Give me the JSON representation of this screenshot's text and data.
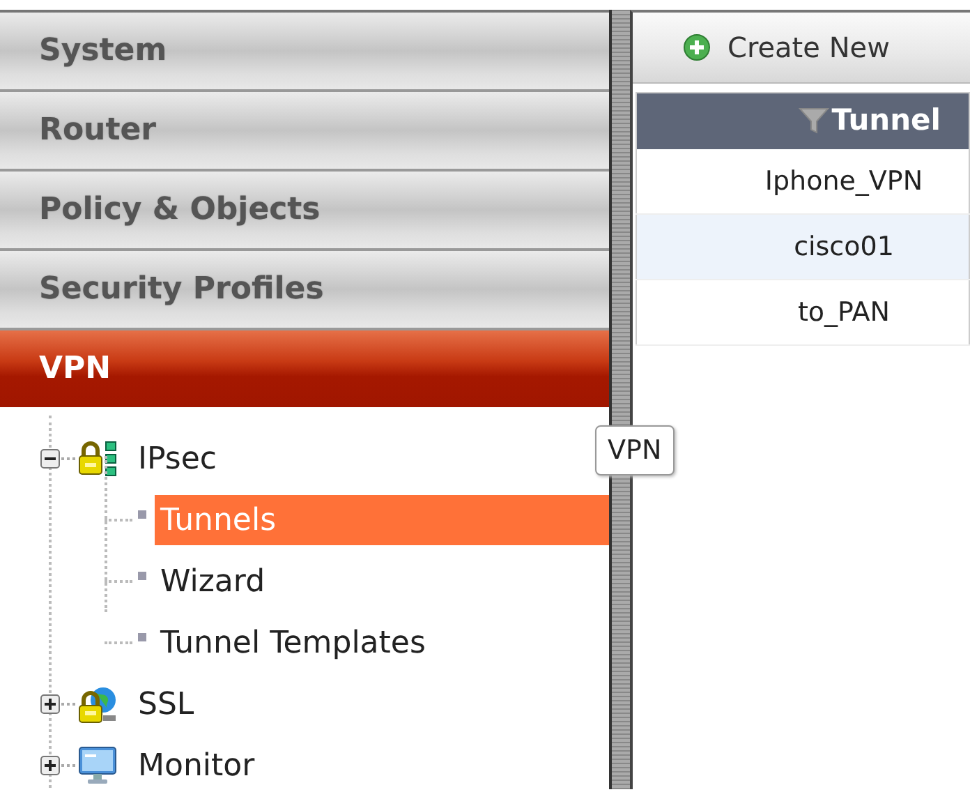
{
  "nav_sections": [
    {
      "label": "System",
      "selected": false
    },
    {
      "label": "Router",
      "selected": false
    },
    {
      "label": "Policy & Objects",
      "selected": false
    },
    {
      "label": "Security Profiles",
      "selected": false
    },
    {
      "label": "VPN",
      "selected": true
    }
  ],
  "tree": [
    {
      "label": "IPsec",
      "kind": "lock-network",
      "expanded": true,
      "selected": false,
      "children": [
        {
          "label": "Tunnels",
          "selected": true
        },
        {
          "label": "Wizard",
          "selected": false
        },
        {
          "label": "Tunnel Templates",
          "selected": false
        }
      ]
    },
    {
      "label": "SSL",
      "kind": "lock-globe",
      "expanded": false,
      "selected": false
    },
    {
      "label": "Monitor",
      "kind": "monitor",
      "expanded": false,
      "selected": false
    }
  ],
  "tooltip": {
    "text": "VPN"
  },
  "toolbar": {
    "create_button": "Create New"
  },
  "table": {
    "columns": [
      {
        "label": "Tunnel",
        "filter": true
      }
    ],
    "rows": [
      {
        "cells": [
          "Iphone_VPN"
        ],
        "selected": false
      },
      {
        "cells": [
          "cisco01"
        ],
        "selected": true
      },
      {
        "cells": [
          "to_PAN"
        ],
        "selected": false
      }
    ]
  }
}
